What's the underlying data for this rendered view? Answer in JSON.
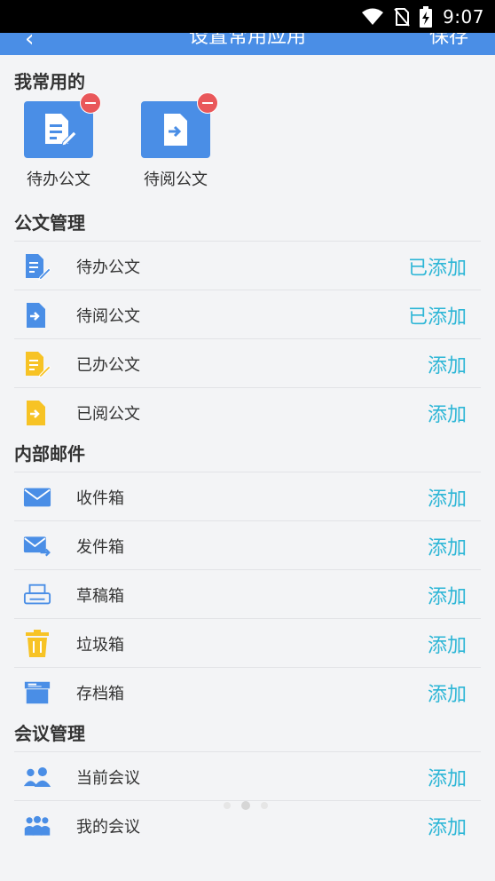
{
  "status_bar": {
    "time": "9:07"
  },
  "app_bar": {
    "back_icon": "back-arrow-icon",
    "title": "设置常用应用",
    "action_label": "保存"
  },
  "favorites": {
    "title": "我常用的",
    "items": [
      {
        "label": "待办公文",
        "icon": "doc-edit-icon"
      },
      {
        "label": "待阅公文",
        "icon": "doc-arrow-icon"
      }
    ]
  },
  "sections": [
    {
      "title": "公文管理",
      "items": [
        {
          "label": "待办公文",
          "action": "已添加",
          "icon": "doc-edit-icon",
          "color": "#4a8ee6"
        },
        {
          "label": "待阅公文",
          "action": "已添加",
          "icon": "doc-arrow-icon",
          "color": "#4a8ee6"
        },
        {
          "label": "已办公文",
          "action": "添加",
          "icon": "doc-edit-icon",
          "color": "#f7c325"
        },
        {
          "label": "已阅公文",
          "action": "添加",
          "icon": "doc-arrow-icon",
          "color": "#f7c325"
        }
      ]
    },
    {
      "title": "内部邮件",
      "items": [
        {
          "label": "收件箱",
          "action": "添加",
          "icon": "envelope-icon",
          "color": "#4a8ee6"
        },
        {
          "label": "发件箱",
          "action": "添加",
          "icon": "envelope-send-icon",
          "color": "#4a8ee6"
        },
        {
          "label": "草稿箱",
          "action": "添加",
          "icon": "printer-icon",
          "color": "#4a8ee6"
        },
        {
          "label": "垃圾箱",
          "action": "添加",
          "icon": "trash-icon",
          "color": "#f7c325"
        },
        {
          "label": "存档箱",
          "action": "添加",
          "icon": "archive-box-icon",
          "color": "#4a8ee6"
        }
      ]
    },
    {
      "title": "会议管理",
      "items": [
        {
          "label": "当前会议",
          "action": "添加",
          "icon": "people-icon",
          "color": "#4a8ee6"
        },
        {
          "label": "我的会议",
          "action": "添加",
          "icon": "group-icon",
          "color": "#4a8ee6"
        }
      ]
    }
  ],
  "colors": {
    "accent": "#4a8ee6",
    "action_text": "#2db6d6",
    "remove_badge": "#e9575a",
    "yellow": "#f7c325"
  }
}
